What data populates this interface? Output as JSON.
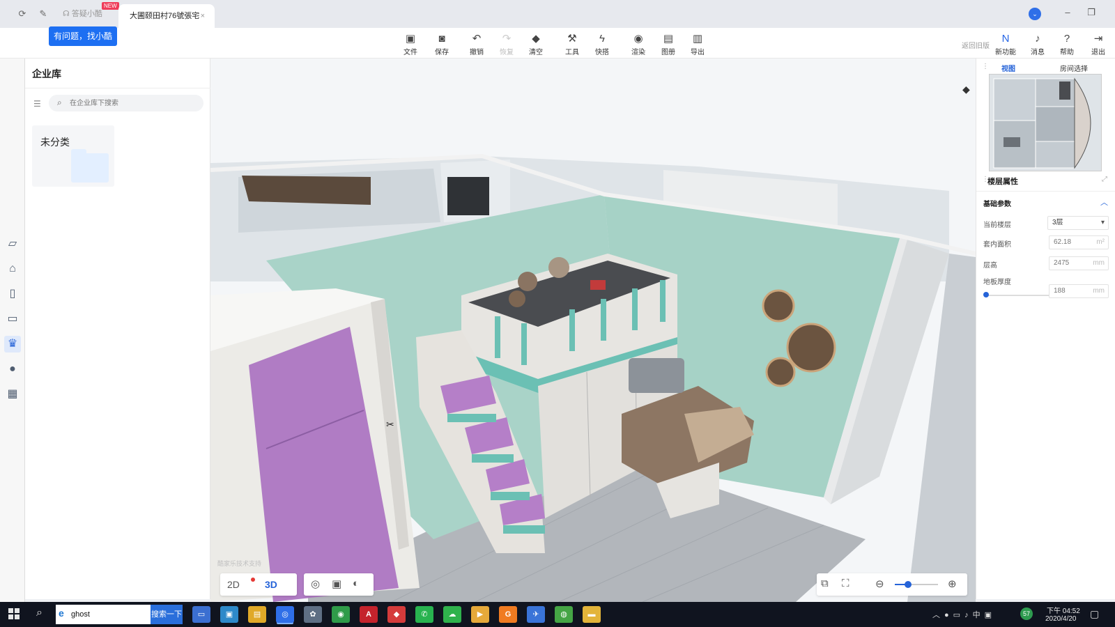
{
  "titlebar": {
    "assistant_tab": "答疑小酷",
    "new_badge": "NEW",
    "active_tab": "大圃颐田村76號張宅",
    "close_glyph": "×"
  },
  "help_tooltip": "有问题，找小酷",
  "toolbar": {
    "file": "文件",
    "save": "保存",
    "undo": "撤销",
    "redo": "恢复",
    "clear": "清空",
    "tools": "工具",
    "quick": "快搭",
    "render": "渲染",
    "album": "图册",
    "export": "导出",
    "back_old": "返回旧版",
    "new_features": "新功能",
    "messages": "消息",
    "help": "帮助",
    "exit": "退出"
  },
  "library": {
    "title": "企业库",
    "search_placeholder": "在企业库下搜索",
    "category": "未分类"
  },
  "canvas": {
    "watermark": "酷家乐技术支持",
    "view_2d": "2D",
    "view_3d": "3D"
  },
  "right_panel": {
    "tab_view": "视图",
    "tab_room": "房间选择",
    "floor_props_title": "楼层属性",
    "basic_params": "基础参数",
    "props": {
      "current_floor_label": "当前楼层",
      "current_floor_value": "3层",
      "inner_area_label": "套内面积",
      "inner_area_value": "62.18",
      "inner_area_unit": "m²",
      "height_label": "层高",
      "height_value": "2475",
      "height_unit": "mm",
      "floor_thickness_label": "地板厚度",
      "floor_thickness_value": "188",
      "floor_thickness_unit": "mm"
    }
  },
  "taskbar": {
    "search_text": "ghost",
    "search_button": "搜索一下",
    "tray_badge": "57",
    "ime": "中",
    "time": "下午 04:52",
    "date": "2020/4/20"
  }
}
